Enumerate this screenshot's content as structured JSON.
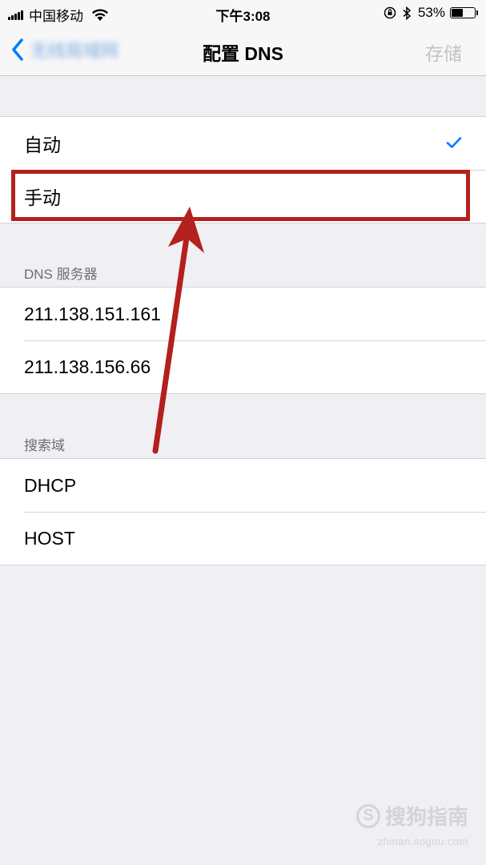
{
  "status_bar": {
    "carrier": "中国移动",
    "time": "下午3:08",
    "battery_percent": "53%",
    "battery_level": 0.53
  },
  "nav": {
    "back_label": "无线局域网",
    "title": "配置 DNS",
    "save_label": "存储"
  },
  "config_mode": {
    "options": [
      {
        "label": "自动",
        "selected": true
      },
      {
        "label": "手动",
        "selected": false
      }
    ]
  },
  "dns_section": {
    "header": "DNS 服务器",
    "servers": [
      "211.138.151.161",
      "211.138.156.66"
    ]
  },
  "search_domain_section": {
    "header": "搜索域",
    "domains": [
      "DHCP",
      "HOST"
    ]
  },
  "watermark": {
    "title": "搜狗指南",
    "subtitle": "zhinan.sogou.com"
  },
  "colors": {
    "ios_blue": "#007aff",
    "annotation_red": "#b3201d",
    "background": "#efeff4"
  }
}
